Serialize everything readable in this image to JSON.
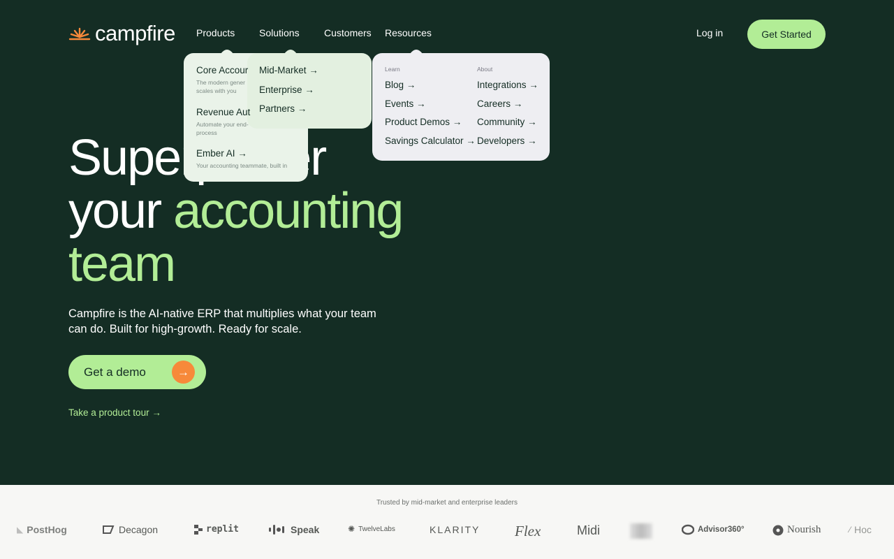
{
  "header": {
    "brand": "campfire",
    "nav": [
      "Products",
      "Solutions",
      "Customers",
      "Resources"
    ],
    "login": "Log in",
    "cta": "Get Started"
  },
  "products_menu": [
    {
      "label": "Core Accour",
      "desc": "The modern gener\nscales with you"
    },
    {
      "label": "Revenue Aut",
      "desc": "Automate your end-\nprocess"
    },
    {
      "label": "Ember AI →",
      "desc": "Your accounting teammate, built in"
    }
  ],
  "solutions_menu": [
    "Mid-Market →",
    "Enterprise →",
    "Partners →"
  ],
  "resources_menu": {
    "learn_heading": "Learn",
    "about_heading": "About",
    "learn": [
      "Blog →",
      "Events →",
      "Product Demos →",
      "Savings Calculator →"
    ],
    "about": [
      "Integrations →",
      "Careers →",
      "Community →",
      "Developers →"
    ]
  },
  "hero": {
    "line1": "Superpower",
    "line2_a": "your ",
    "line2_b": "accounting",
    "line3": "team",
    "subtitle": "Campfire is the AI-native ERP that multiplies what your team can do. Built for high-growth. Ready for scale.",
    "demo_button": "Get a demo",
    "tour_link": "Take a product tour →"
  },
  "trusted": {
    "label": "Trusted by mid-market and enterprise leaders",
    "brands": [
      "PostHog",
      "Decagon",
      "replit",
      "Speak",
      "TwelveLabs",
      "KLARITY",
      "Flex",
      "Midi",
      "Advisor360°",
      "Nourish",
      "Hoc"
    ]
  },
  "colors": {
    "bg": "#142d24",
    "accent": "#b2ed96",
    "orange": "#f7893a"
  }
}
